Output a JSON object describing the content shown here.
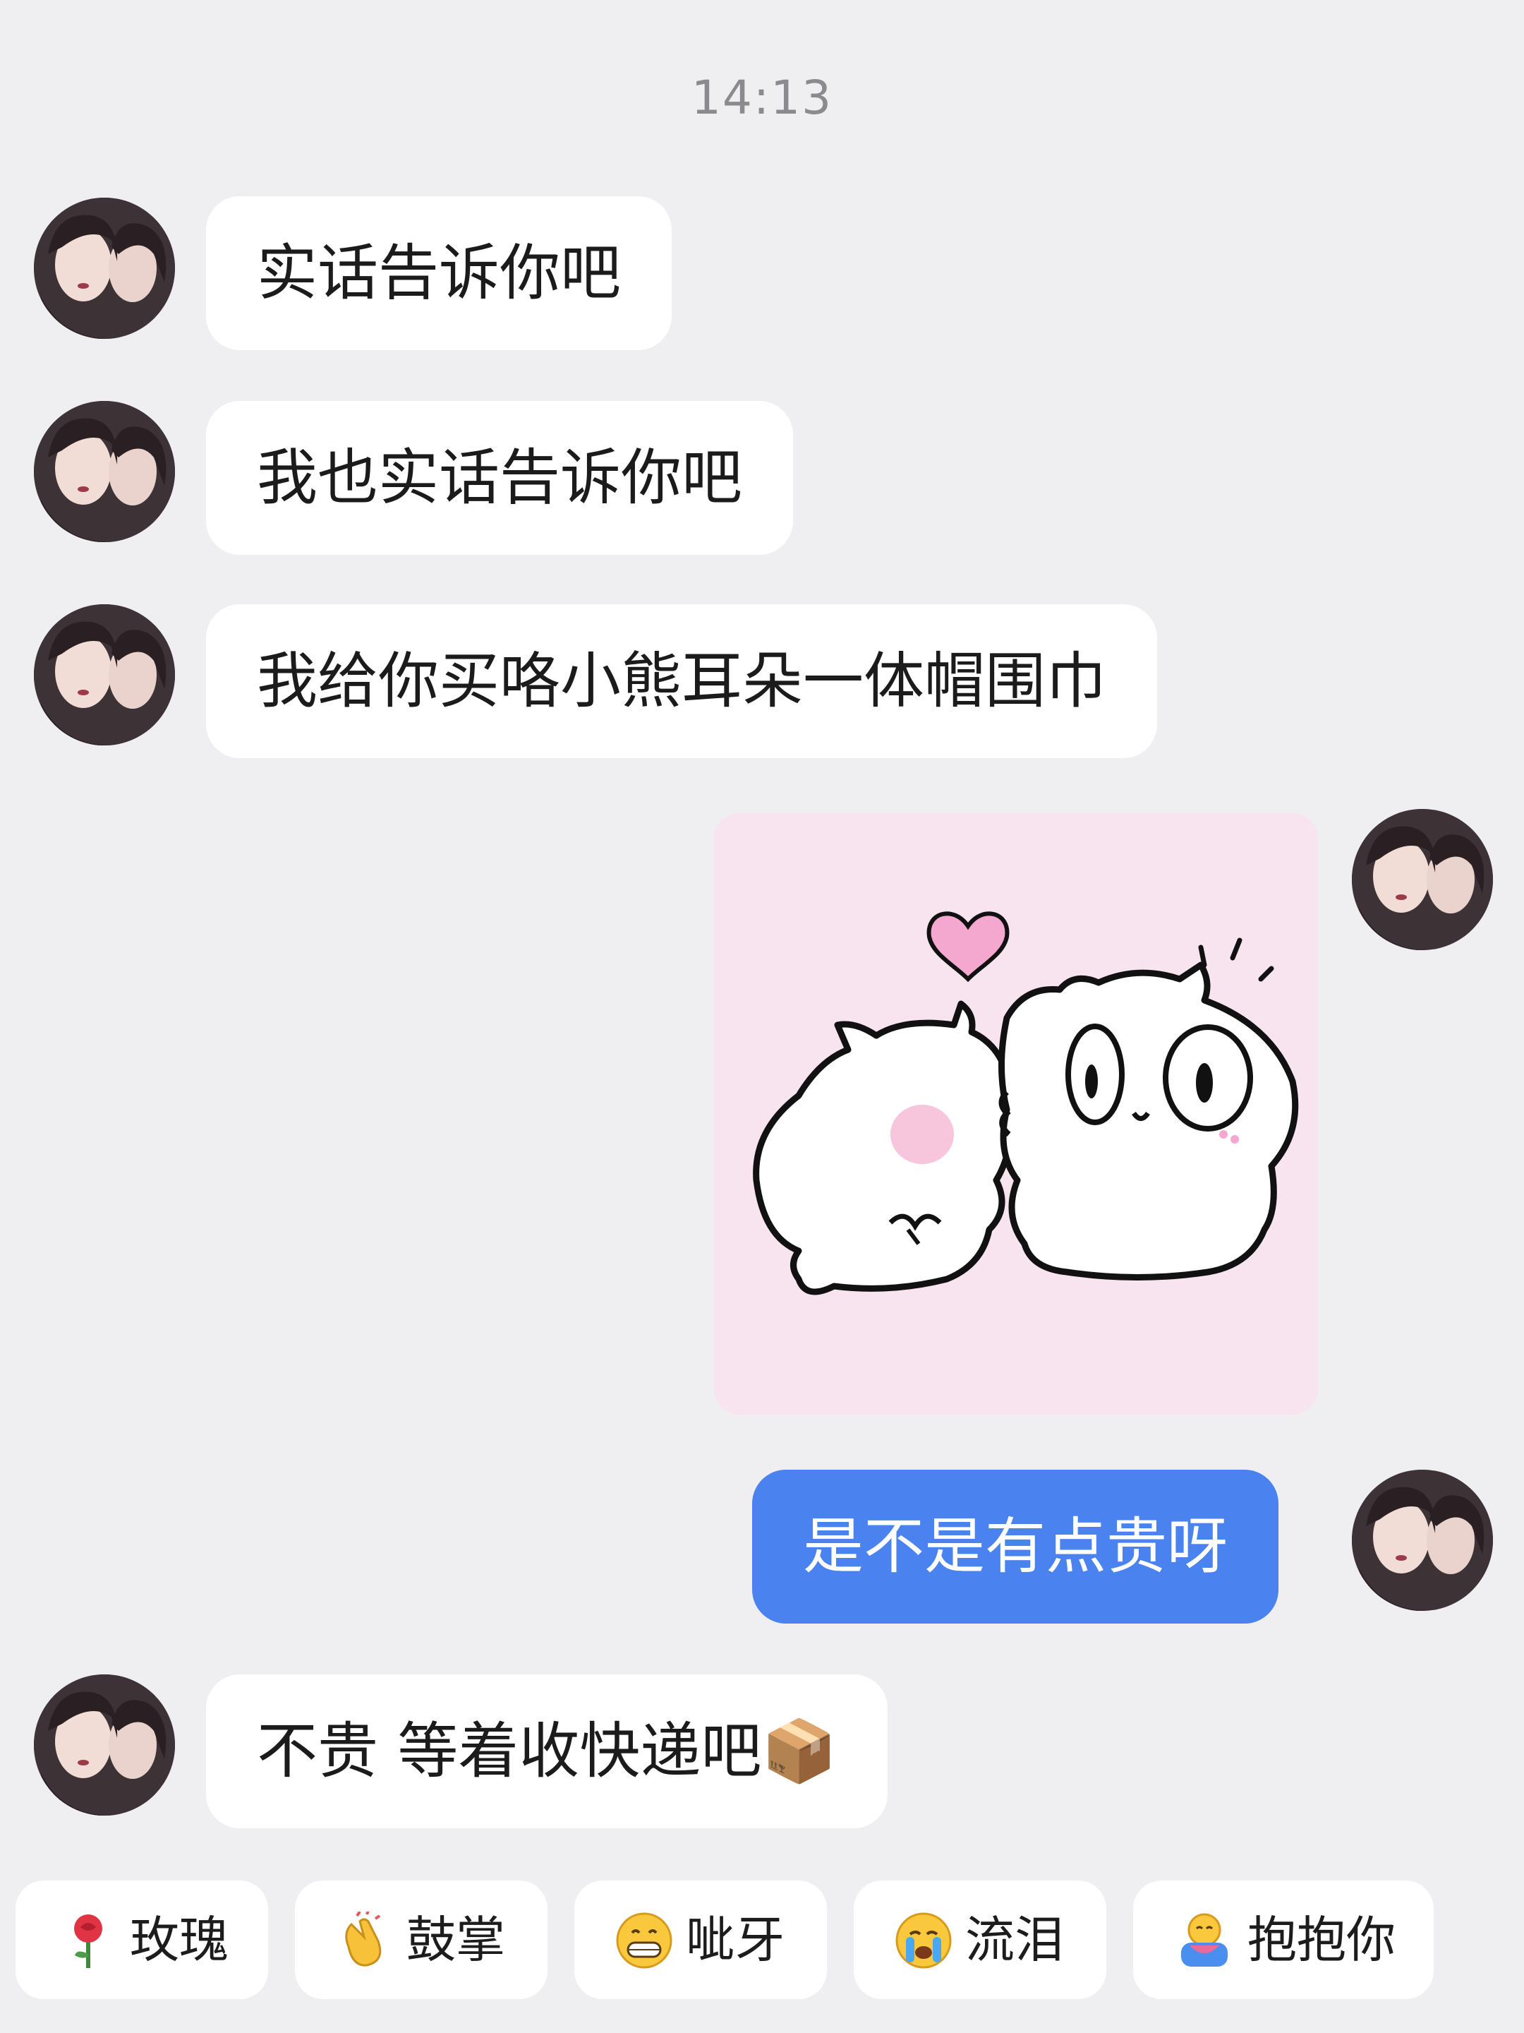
{
  "timestamp": "14:13",
  "messages": [
    {
      "side": "received",
      "text": "实话告诉你吧"
    },
    {
      "side": "received",
      "text": "我也实话告诉你吧"
    },
    {
      "side": "received",
      "text": "我给你买咯小熊耳朵一体帽围巾"
    },
    {
      "side": "sent",
      "type": "sticker",
      "sticker_name": "two-cartoon-cats-kiss-sticker"
    },
    {
      "side": "sent",
      "text": "是不是有点贵呀"
    },
    {
      "side": "received",
      "text": "不贵 等着收快递吧📦"
    }
  ],
  "quick_replies": [
    {
      "icon": "rose-icon",
      "label": "玫瑰"
    },
    {
      "icon": "clapping-hands-icon",
      "label": "鼓掌"
    },
    {
      "icon": "grinning-face-icon",
      "label": "呲牙"
    },
    {
      "icon": "crying-face-icon",
      "label": "流泪"
    },
    {
      "icon": "hugging-face-icon",
      "label": "抱抱你"
    }
  ],
  "colors": {
    "background": "#efeff1",
    "received_bubble": "#ffffff",
    "sent_bubble": "#4a82f0",
    "sticker_background": "#f7e4ef"
  }
}
